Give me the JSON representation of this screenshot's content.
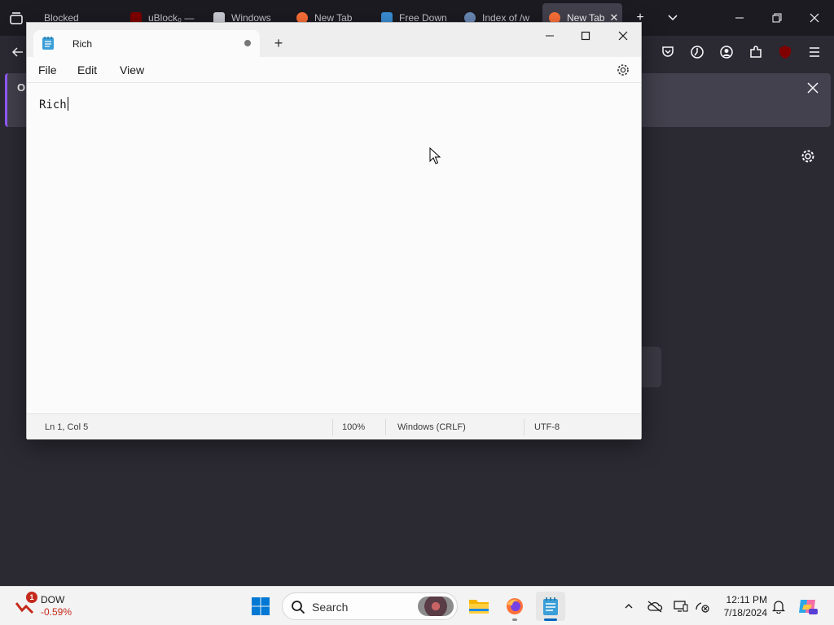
{
  "firefox": {
    "tabs": [
      {
        "label": "Blocked",
        "icon": "blocked-icon"
      },
      {
        "label": "uBlock₀ —",
        "icon": "ublock-icon"
      },
      {
        "label": "Windows",
        "icon": "trash-icon"
      },
      {
        "label": "New Tab",
        "icon": "firefox-icon"
      },
      {
        "label": "Free Down",
        "icon": "download-site-icon"
      },
      {
        "label": "Index of /w",
        "icon": "globe-icon"
      },
      {
        "label": "New Tab",
        "icon": "firefox-icon"
      }
    ],
    "notice_visible_text": "O",
    "accent": "#9059ff"
  },
  "notepad": {
    "tab_title": "Rich",
    "menu": {
      "file": "File",
      "edit": "Edit",
      "view": "View"
    },
    "content": "Rich",
    "status": {
      "position": "Ln 1, Col 5",
      "zoom": "100%",
      "line_ending": "Windows (CRLF)",
      "encoding": "UTF-8"
    }
  },
  "taskbar": {
    "stock": {
      "name": "DOW",
      "change": "-0.59%",
      "badge": "1"
    },
    "search_placeholder": "Search",
    "clock": {
      "time": "12:11 PM",
      "date": "7/18/2024"
    },
    "accent": "#0067c0"
  }
}
